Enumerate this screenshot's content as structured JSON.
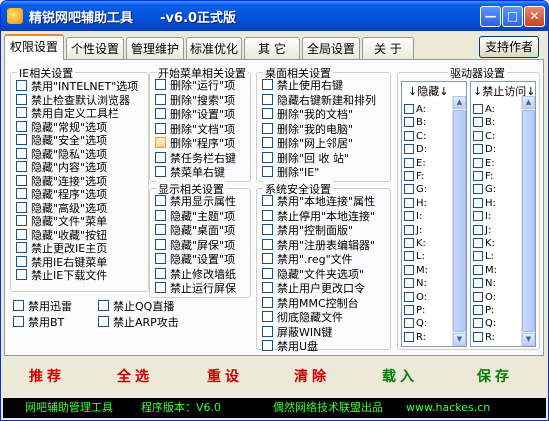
{
  "window": {
    "title": "精锐网吧辅助工具      -v6.0正式版",
    "accent": "#0553e0"
  },
  "tabs": [
    "权限设置",
    "个性设置",
    "管理维护",
    "标准优化",
    "其 它",
    "全局设置",
    "关 于"
  ],
  "support_button": "支持作者",
  "ie_group": {
    "title": "IE相关设置",
    "items": [
      "禁用\"INTELNET\"选项",
      "禁止检查默认浏览器",
      "禁用自定义工具栏",
      "隐藏\"常规\"选项",
      "隐藏\"安全\"选项",
      "隐藏\"隐私\"选项",
      "隐藏\"内容\"选项",
      "隐藏\"连接\"选项",
      "隐藏\"程序\"选项",
      "隐藏\"高级\"选项",
      "隐藏\"文件\"菜单",
      "隐藏\"收藏\"按钮",
      "禁止更改IE主页",
      "禁用IE右键菜单",
      "禁止IE下载文件"
    ]
  },
  "extra": {
    "items": [
      "禁用迅雷",
      "禁止QQ直播",
      "禁用BT",
      "禁止ARP攻击"
    ]
  },
  "start_group": {
    "title": "开始菜单相关设置",
    "items": [
      "删除\"运行\"项",
      "删除\"搜索\"项",
      "删除\"设置\"项",
      "删除\"文档\"项",
      "删除\"程序\"项",
      "禁任务栏右键",
      "禁菜单右键"
    ]
  },
  "display_group": {
    "title": "显示相关设置",
    "items": [
      "禁用显示属性",
      "隐藏\"主题\"项",
      "隐藏\"桌面\"项",
      "隐藏\"屏保\"项",
      "隐藏\"设置\"项",
      "禁止修改墙纸",
      "禁止运行屏保"
    ]
  },
  "desktop_group": {
    "title": "桌面相关设置",
    "items": [
      "禁止使用右键",
      "隐藏右键新建和排列",
      "删除\"我的文档\"",
      "删除\"我的电脑\"",
      "删除\"网上邻居\"",
      "删除\"回 收 站\"",
      "删除\"IE\""
    ]
  },
  "security_group": {
    "title": "系统安全设置",
    "items": [
      "禁用\"本地连接\"属性",
      "禁止停用\"本地连接\"",
      "禁用\"控制面版\"",
      "禁用\"注册表编辑器\"",
      "禁用\".reg\"文件",
      "隐藏\"文件夹选项\"",
      "禁止用户更改口令",
      "禁用MMC控制台",
      "彻底隐藏文件",
      "屏蔽WIN键",
      "禁用U盘"
    ]
  },
  "drive_group": {
    "title": "驱动器设置",
    "hide_label": "↓隐藏↓",
    "block_label": "↓禁止访问↓",
    "drives": [
      "A:",
      "B:",
      "C:",
      "D:",
      "E:",
      "F:",
      "G:",
      "H:",
      "I:",
      "J:",
      "K:",
      "L:",
      "M:",
      "N:",
      "O:",
      "P:",
      "Q:",
      "R:"
    ]
  },
  "actions": [
    "推荐",
    "全选",
    "重设",
    "清除",
    "载入",
    "保存"
  ],
  "status": {
    "app_name": "网吧辅助管理工具",
    "version": "程序版本：V6.0",
    "vendor": "偶然网络技术联盟出品",
    "url": "www.hackes.cn"
  }
}
